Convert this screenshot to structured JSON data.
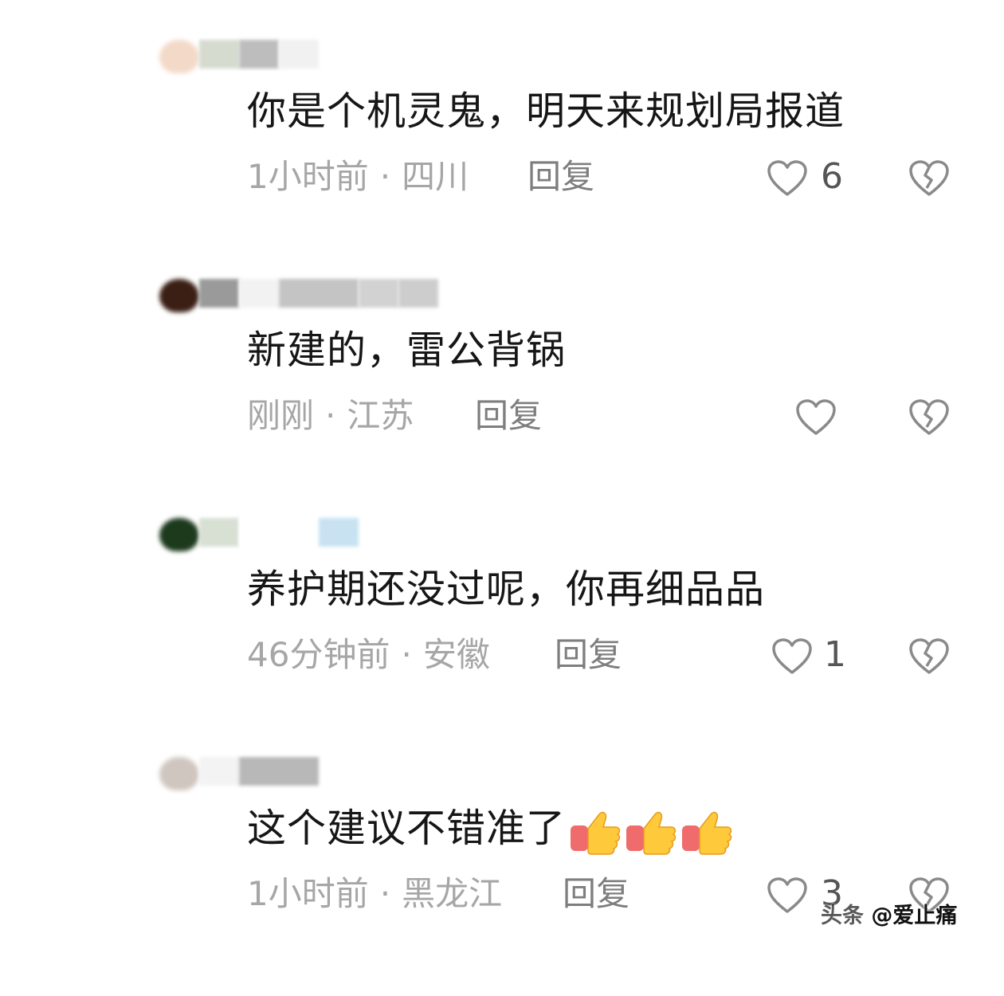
{
  "comments": [
    {
      "text": "你是个机灵鬼，明天来规划局报道",
      "time": "1小时前",
      "location": "四川",
      "reply_label": "回复",
      "like_count": "6"
    },
    {
      "text": "新建的，雷公背锅",
      "time": "刚刚",
      "location": "江苏",
      "reply_label": "回复",
      "like_count": ""
    },
    {
      "text": "养护期还没过呢，你再细品品",
      "time": "46分钟前",
      "location": "安徽",
      "reply_label": "回复",
      "like_count": "1"
    },
    {
      "text": "这个建议不错准了",
      "time": "1小时前",
      "location": "黑龙江",
      "reply_label": "回复",
      "like_count": "3",
      "emoji": "thumbs-up-icon"
    }
  ],
  "separator": "·",
  "watermark": {
    "prefix": "头条",
    "handle": "@爱止痛"
  },
  "colors": {
    "text": "#161616",
    "meta": "#a6a6a6",
    "icon": "#8a8a8a"
  }
}
